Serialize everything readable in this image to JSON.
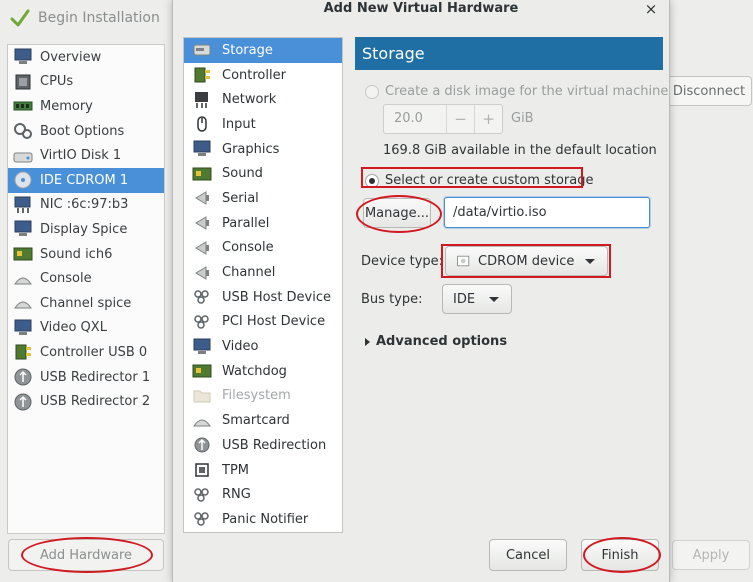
{
  "main_window": {
    "begin_installation": "Begin Installation",
    "devices": [
      {
        "label": "Overview",
        "icon": "overview-icon"
      },
      {
        "label": "CPUs",
        "icon": "cpu-icon"
      },
      {
        "label": "Memory",
        "icon": "memory-icon"
      },
      {
        "label": "Boot Options",
        "icon": "boot-options-icon"
      },
      {
        "label": "VirtIO Disk 1",
        "icon": "disk-icon"
      },
      {
        "label": "IDE CDROM 1",
        "icon": "cdrom-icon",
        "selected": true
      },
      {
        "label": "NIC :6c:97:b3",
        "icon": "nic-icon"
      },
      {
        "label": "Display Spice",
        "icon": "display-icon"
      },
      {
        "label": "Sound ich6",
        "icon": "sound-icon"
      },
      {
        "label": "Console",
        "icon": "console-icon"
      },
      {
        "label": "Channel spice",
        "icon": "channel-icon"
      },
      {
        "label": "Video QXL",
        "icon": "video-icon"
      },
      {
        "label": "Controller USB 0",
        "icon": "controller-icon"
      },
      {
        "label": "USB Redirector 1",
        "icon": "usb-redirector-icon"
      },
      {
        "label": "USB Redirector 2",
        "icon": "usb-redirector-icon"
      }
    ],
    "add_hardware": "Add Hardware",
    "disconnect": "Disconnect",
    "apply": "Apply"
  },
  "dialog": {
    "title": "Add New Virtual Hardware",
    "close": "×",
    "hardware_types": [
      {
        "label": "Storage",
        "icon": "storage-icon",
        "selected": true
      },
      {
        "label": "Controller",
        "icon": "controller-icon"
      },
      {
        "label": "Network",
        "icon": "network-icon"
      },
      {
        "label": "Input",
        "icon": "mouse-icon"
      },
      {
        "label": "Graphics",
        "icon": "monitor-icon"
      },
      {
        "label": "Sound",
        "icon": "sound-card-icon"
      },
      {
        "label": "Serial",
        "icon": "serial-port-icon"
      },
      {
        "label": "Parallel",
        "icon": "parallel-port-icon"
      },
      {
        "label": "Console",
        "icon": "console-port-icon"
      },
      {
        "label": "Channel",
        "icon": "channel-port-icon"
      },
      {
        "label": "USB Host Device",
        "icon": "usb-host-icon"
      },
      {
        "label": "PCI Host Device",
        "icon": "pci-host-icon"
      },
      {
        "label": "Video",
        "icon": "video-icon"
      },
      {
        "label": "Watchdog",
        "icon": "watchdog-icon"
      },
      {
        "label": "Filesystem",
        "icon": "folder-icon",
        "disabled": true
      },
      {
        "label": "Smartcard",
        "icon": "smartcard-icon"
      },
      {
        "label": "USB Redirection",
        "icon": "usb-redirection-icon"
      },
      {
        "label": "TPM",
        "icon": "tpm-icon"
      },
      {
        "label": "RNG",
        "icon": "rng-icon"
      },
      {
        "label": "Panic Notifier",
        "icon": "panic-notifier-icon"
      }
    ],
    "storage": {
      "header": "Storage",
      "create_disk_label": "Create a disk image for the virtual machine",
      "disk_size_value": "20.0",
      "decrement": "−",
      "increment": "+",
      "size_unit": "GiB",
      "available_text": "169.8 GiB available in the default location",
      "custom_storage_label": "Select or create custom storage",
      "manage_button": "Manage...",
      "path_value": "/data/virtio.iso",
      "device_type_label": "Device type:",
      "device_type_value": "CDROM device",
      "bus_type_label": "Bus type:",
      "bus_type_value": "IDE",
      "advanced_options": "Advanced options"
    },
    "cancel": "Cancel",
    "finish": "Finish"
  },
  "colors": {
    "selection": "#4a90d9",
    "panel_header": "#1f6ea4",
    "annotation_red": "#d1191f"
  }
}
